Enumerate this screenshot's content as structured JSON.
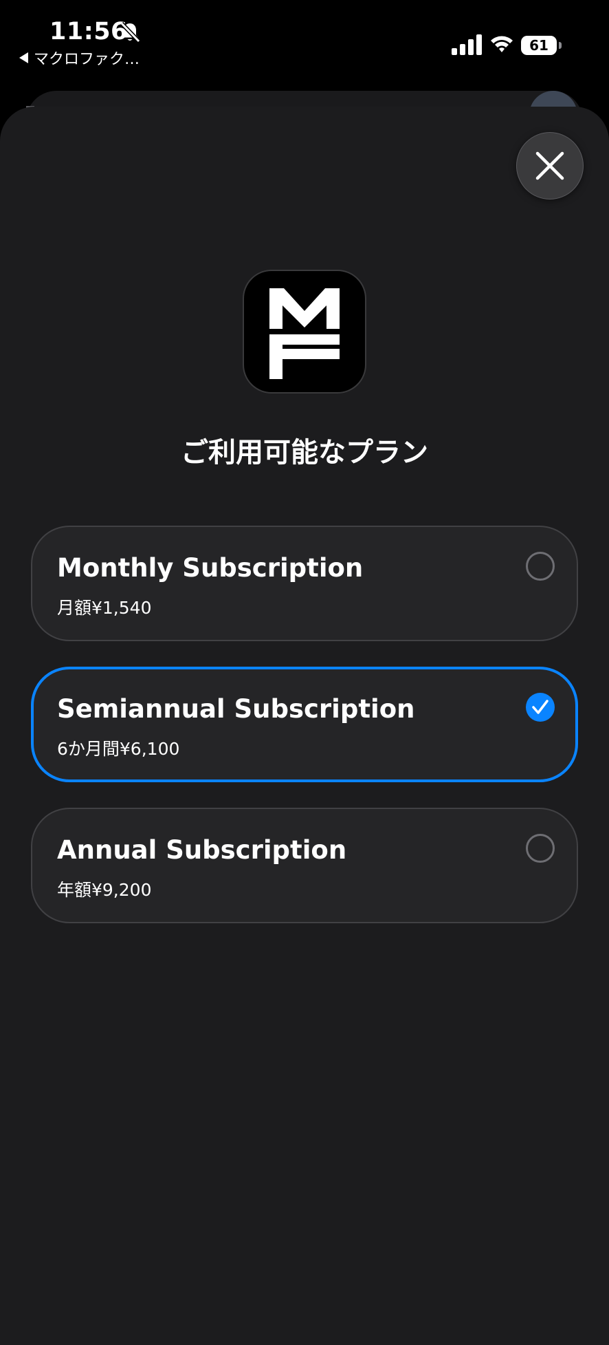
{
  "status_bar": {
    "time": "11:56",
    "back_app": "マクロファク…",
    "battery": "61"
  },
  "heading": "ご利用可能なプラン",
  "plans": [
    {
      "title": "Monthly Subscription",
      "price": "月額¥1,540",
      "selected": false
    },
    {
      "title": "Semiannual Subscription",
      "price": "6か月間¥6,100",
      "selected": true
    },
    {
      "title": "Annual Subscription",
      "price": "年額¥9,200",
      "selected": false
    }
  ],
  "icons": {
    "bell": "bell-slash-icon",
    "back": "back-triangle-icon",
    "signal": "cellular-signal-icon",
    "wifi": "wifi-icon",
    "battery": "battery-icon",
    "close": "close-icon",
    "check": "checkmark-icon",
    "logo": "mf-app-logo"
  },
  "colors": {
    "accent": "#0a84ff",
    "sheet_bg": "#1c1c1e",
    "card_bg": "#252527"
  }
}
